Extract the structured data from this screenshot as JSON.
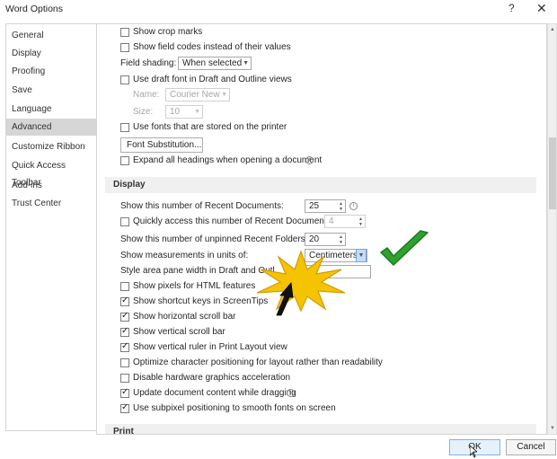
{
  "window": {
    "title": "Word Options",
    "help_glyph": "?",
    "close_glyph": "✕"
  },
  "sidebar": {
    "items": [
      {
        "label": "General"
      },
      {
        "label": "Display"
      },
      {
        "label": "Proofing"
      },
      {
        "label": "Save"
      },
      {
        "label": "Language"
      },
      {
        "label": "Advanced",
        "active": true
      },
      {
        "label": "Customize Ribbon"
      },
      {
        "label": "Quick Access Toolbar"
      },
      {
        "label": "Add-ins"
      },
      {
        "label": "Trust Center"
      }
    ]
  },
  "show_content": {
    "crop_marks": {
      "label": "Show crop marks",
      "checked": false
    },
    "field_codes": {
      "label": "Show field codes instead of their values",
      "checked": false
    },
    "field_shading": {
      "label": "Field shading:",
      "value": "When selected"
    },
    "draft_font": {
      "label": "Use draft font in Draft and Outline views",
      "checked": false
    },
    "name": {
      "label": "Name:",
      "value": "Courier New"
    },
    "size": {
      "label": "Size:",
      "value": "10"
    },
    "printer_fonts": {
      "label": "Use fonts that are stored on the printer",
      "checked": false
    },
    "font_substitution": {
      "label": "Font Substitution..."
    },
    "expand_headings": {
      "label": "Expand all headings when opening a document",
      "checked": false
    }
  },
  "display": {
    "header": "Display",
    "recent_docs": {
      "label": "Show this number of Recent Documents:",
      "value": "25"
    },
    "quick_access": {
      "label": "Quickly access this number of Recent Documents:",
      "value": "4",
      "checked": false
    },
    "recent_folders": {
      "label": "Show this number of unpinned Recent Folders:",
      "value": "20"
    },
    "measurements": {
      "label": "Show measurements in units of:",
      "value": "Centimeters"
    },
    "style_area": {
      "label": "Style area pane width in Draft and Outl",
      "value": ""
    },
    "pixels_html": {
      "label": "Show pixels for HTML features",
      "checked": false
    },
    "shortcut_keys": {
      "label": "Show shortcut keys in ScreenTips",
      "checked": true
    },
    "horizontal_scroll": {
      "label": "Show horizontal scroll bar",
      "checked": true
    },
    "vertical_scroll": {
      "label": "Show vertical scroll bar",
      "checked": true
    },
    "vertical_ruler": {
      "label": "Show vertical ruler in Print Layout view",
      "checked": true
    },
    "char_positioning": {
      "label": "Optimize character positioning for layout rather than readability",
      "checked": false
    },
    "hw_acceleration": {
      "label": "Disable hardware graphics acceleration",
      "checked": false
    },
    "update_dragging": {
      "label": "Update document content while dragging",
      "checked": true
    },
    "subpixel": {
      "label": "Use subpixel positioning to smooth fonts on screen",
      "checked": true
    }
  },
  "print": {
    "header": "Print"
  },
  "footer": {
    "ok_label": "OK",
    "cancel_label": "Cancel"
  },
  "colors": {
    "check_green": "#2ea12e",
    "starburst": "#f5c400",
    "active_nav": "#d6d6d6"
  }
}
